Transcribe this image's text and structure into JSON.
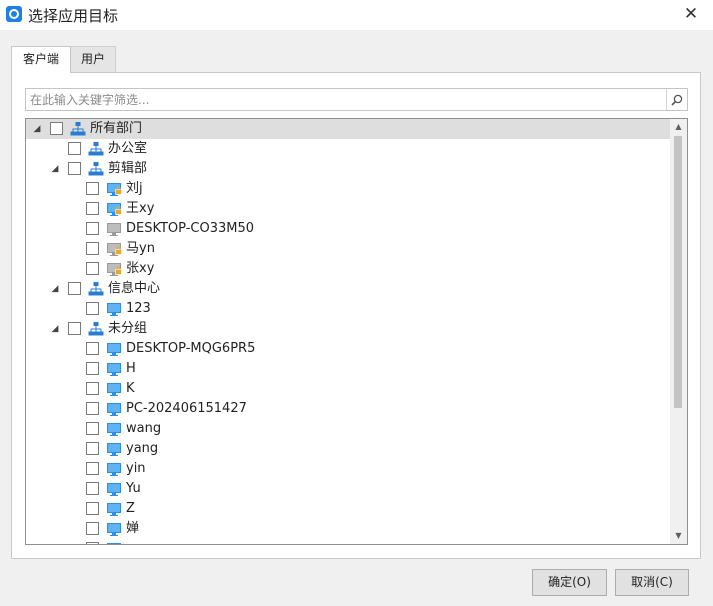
{
  "window": {
    "title": "选择应用目标",
    "close_glyph": "✕"
  },
  "tabs": [
    {
      "label": "客户端",
      "active": true
    },
    {
      "label": "用户",
      "active": false
    }
  ],
  "search": {
    "placeholder": "在此输入关键字筛选...",
    "value": ""
  },
  "colors": {
    "accent": "#1e7fe6",
    "org_icon": "#2b7cd3",
    "monitor_online": "#2b8ee8",
    "monitor_offline": "#9a9a9a",
    "lock_badge": "#e8a92b"
  },
  "tree": [
    {
      "label": "所有部门",
      "level": 0,
      "type": "org",
      "expanded": true,
      "selected": true
    },
    {
      "label": "办公室",
      "level": 1,
      "type": "org"
    },
    {
      "label": "剪辑部",
      "level": 1,
      "type": "org",
      "expanded": true
    },
    {
      "label": "刘j",
      "level": 2,
      "type": "pc",
      "status": "online-locked"
    },
    {
      "label": "王xy",
      "level": 2,
      "type": "pc",
      "status": "online-locked"
    },
    {
      "label": "DESKTOP-CO33M50",
      "level": 2,
      "type": "pc",
      "status": "offline"
    },
    {
      "label": "马yn",
      "level": 2,
      "type": "pc",
      "status": "offline-locked"
    },
    {
      "label": "张xy",
      "level": 2,
      "type": "pc",
      "status": "offline-locked"
    },
    {
      "label": "信息中心",
      "level": 1,
      "type": "org",
      "expanded": true
    },
    {
      "label": "123",
      "level": 2,
      "type": "pc",
      "status": "online"
    },
    {
      "label": "未分组",
      "level": 1,
      "type": "org",
      "expanded": true
    },
    {
      "label": "DESKTOP-MQG6PR5",
      "level": 2,
      "type": "pc",
      "status": "online"
    },
    {
      "label": "H",
      "level": 2,
      "type": "pc",
      "status": "online"
    },
    {
      "label": "K",
      "level": 2,
      "type": "pc",
      "status": "online"
    },
    {
      "label": "PC-202406151427",
      "level": 2,
      "type": "pc",
      "status": "online"
    },
    {
      "label": "wang",
      "level": 2,
      "type": "pc",
      "status": "online"
    },
    {
      "label": "yang",
      "level": 2,
      "type": "pc",
      "status": "online"
    },
    {
      "label": "yin",
      "level": 2,
      "type": "pc",
      "status": "online"
    },
    {
      "label": "Yu",
      "level": 2,
      "type": "pc",
      "status": "online"
    },
    {
      "label": "Z",
      "level": 2,
      "type": "pc",
      "status": "online"
    },
    {
      "label": "婵",
      "level": 2,
      "type": "pc",
      "status": "online"
    },
    {
      "label": "",
      "level": 2,
      "type": "pc",
      "status": "online"
    }
  ],
  "buttons": {
    "ok": "确定(O)",
    "cancel": "取消(C)"
  }
}
